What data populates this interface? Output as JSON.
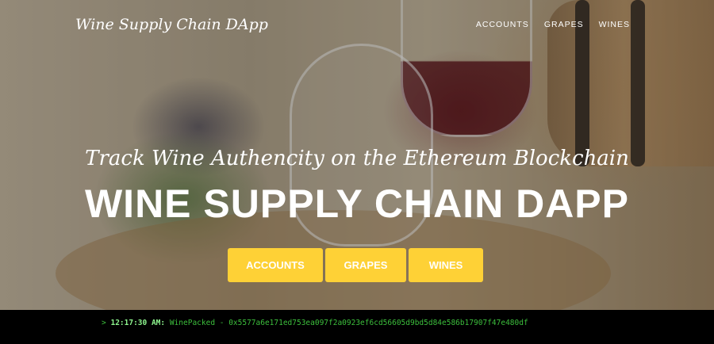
{
  "brand": "Wine Supply Chain DApp",
  "nav": {
    "accounts": "ACCOUNTS",
    "grapes": "GRAPES",
    "wines": "WINES"
  },
  "hero": {
    "subtitle": "Track Wine Authencity on the Ethereum Blockchain",
    "title": "WINE SUPPLY CHAIN DAPP",
    "buttons": {
      "accounts": "ACCOUNTS",
      "grapes": "GRAPES",
      "wines": "WINES"
    }
  },
  "console": {
    "prompt": ">",
    "time": "12:17:30 AM:",
    "message": "WinePacked - 0x5577a6e171ed753ea097f2a0923ef6cd56605d9bd5d84e586b17907f47e480df"
  },
  "colors": {
    "accent": "#fed136",
    "console_text": "#3cbf3c"
  }
}
